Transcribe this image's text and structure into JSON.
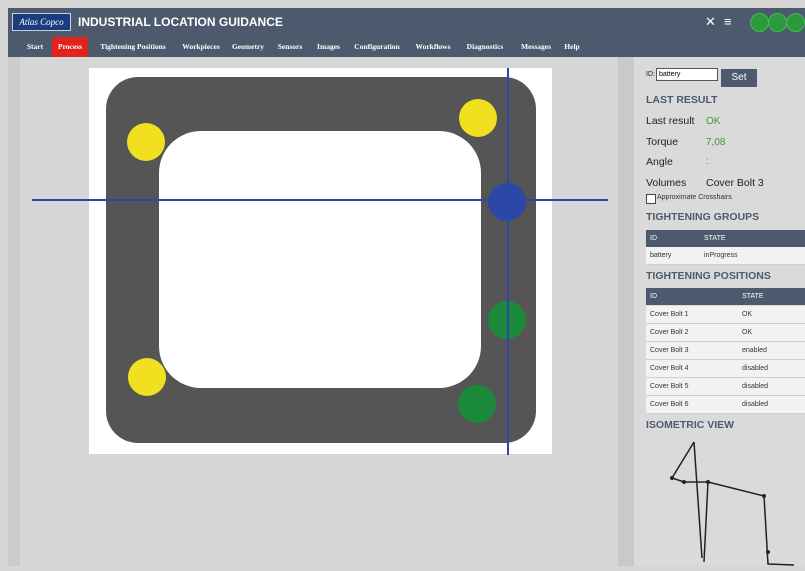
{
  "header": {
    "logo_text": "Atlas Copco",
    "title": "INDUSTRIAL LOCATION GUIDANCE",
    "icons": [
      "crosshair-icon",
      "menu-icon"
    ],
    "status_colors": [
      "#2c9a3c",
      "#2c9a3c",
      "#2c9a3c"
    ]
  },
  "menu": {
    "items": [
      {
        "label": "Start"
      },
      {
        "label": "Process",
        "active": true
      },
      {
        "label": "Tightening Positions"
      },
      {
        "label": "Workpieces"
      },
      {
        "label": "Geometry"
      },
      {
        "label": "Sensors"
      },
      {
        "label": "Images"
      },
      {
        "label": "Configuration"
      },
      {
        "label": "Workflows"
      },
      {
        "label": "Diagnostics"
      },
      {
        "label": "Messages"
      },
      {
        "label": "Help"
      }
    ]
  },
  "workpiece": {
    "frame_color": "#555555",
    "crosshair_color": "#2b47a8",
    "bolt_colors": {
      "disabled": "#f0e020",
      "ok": "#1a8a3a",
      "active": "#2b47a8"
    }
  },
  "panel": {
    "id_label": "ID:",
    "id_value": "battery",
    "set_label": "Set",
    "last_result_heading": "LAST RESULT",
    "last_result_label": "Last result",
    "last_result_value": "OK",
    "torque_label": "Torque",
    "torque_value": "7,08",
    "angle_label": "Angle",
    "angle_value": ":",
    "volumes_label": "Volumes",
    "volumes_value": "Cover Bolt 3",
    "approx_label": "Approximate Crosshairs",
    "groups_heading": "TIGHTENING GROUPS",
    "groups_columns": [
      "ID",
      "STATE"
    ],
    "groups_rows": [
      {
        "id": "battery",
        "state": "inProgress"
      }
    ],
    "positions_heading": "TIGHTENING POSITIONS",
    "positions_columns": [
      "ID",
      "STATE"
    ],
    "positions_rows": [
      {
        "id": "Cover Bolt 1",
        "state": "OK"
      },
      {
        "id": "Cover Bolt 2",
        "state": "OK"
      },
      {
        "id": "Cover Bolt 3",
        "state": "enabled"
      },
      {
        "id": "Cover Bolt 4",
        "state": "disabled"
      },
      {
        "id": "Cover Bolt 5",
        "state": "disabled"
      },
      {
        "id": "Cover Bolt 6",
        "state": "disabled"
      }
    ],
    "iso_heading": "ISOMETRIC VIEW"
  }
}
